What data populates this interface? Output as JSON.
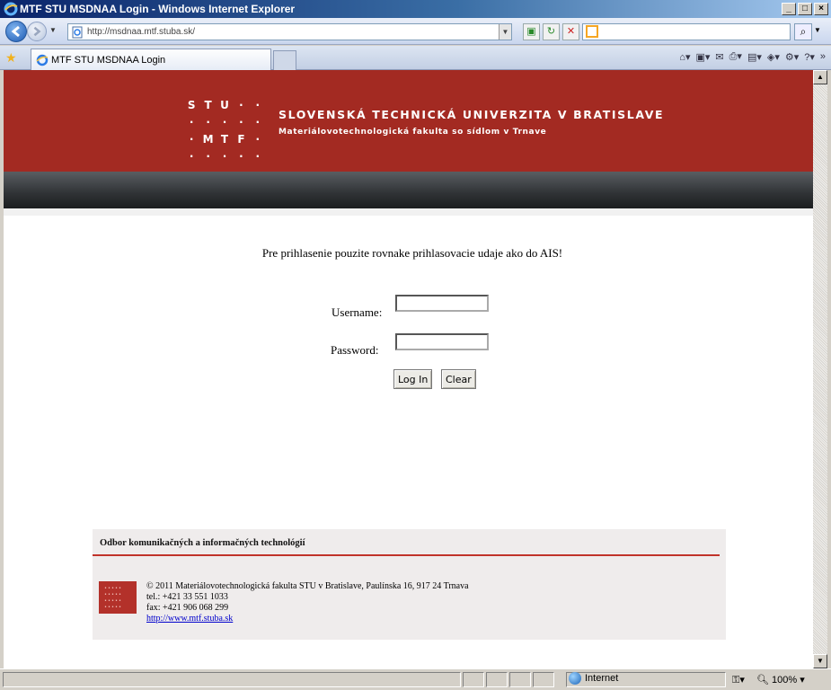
{
  "window": {
    "title": "MTF STU MSDNAA Login - Windows Internet Explorer",
    "buttons": [
      "_",
      "□",
      "×"
    ]
  },
  "nav": {
    "url": "http://msdnaa.mtf.stuba.sk/"
  },
  "tab": {
    "title": "MTF STU MSDNAA Login"
  },
  "header": {
    "logo_rows": [
      [
        "S",
        "T",
        "U",
        "·",
        "·"
      ],
      [
        "·",
        "·",
        "·",
        "·",
        "·"
      ],
      [
        "·",
        "M",
        "T",
        "F",
        "·"
      ],
      [
        "·",
        "·",
        "·",
        "·",
        "·"
      ]
    ],
    "university": "SLOVENSKÁ TECHNICKÁ UNIVERZITA V BRATISLAVE",
    "faculty": "Materiálovotechnologická fakulta so sídlom v Trnave"
  },
  "login": {
    "notice": "Pre prihlasenie pouzite rovnake prihlasovacie udaje ako do AIS!",
    "username_label": "Username:",
    "password_label": "Password:",
    "username_value": "",
    "password_value": "",
    "login_button": "Log In",
    "clear_button": "Clear"
  },
  "footer": {
    "title": "Odbor komunikačných a informačných technológií",
    "copyright": "© 2011 Materiálovotechnologická fakulta STU v Bratislave, Paulínska 16, 917 24 Trnava",
    "tel": "tel.: +421 33 551 1033",
    "fax": "fax: +421 906 068 299",
    "link": "http://www.mtf.stuba.sk"
  },
  "status": {
    "zone": "Internet",
    "zoom": "100%"
  },
  "colors": {
    "header_red": "#a32a22",
    "footer_rule": "#c0322a",
    "link": "#0000cc"
  }
}
